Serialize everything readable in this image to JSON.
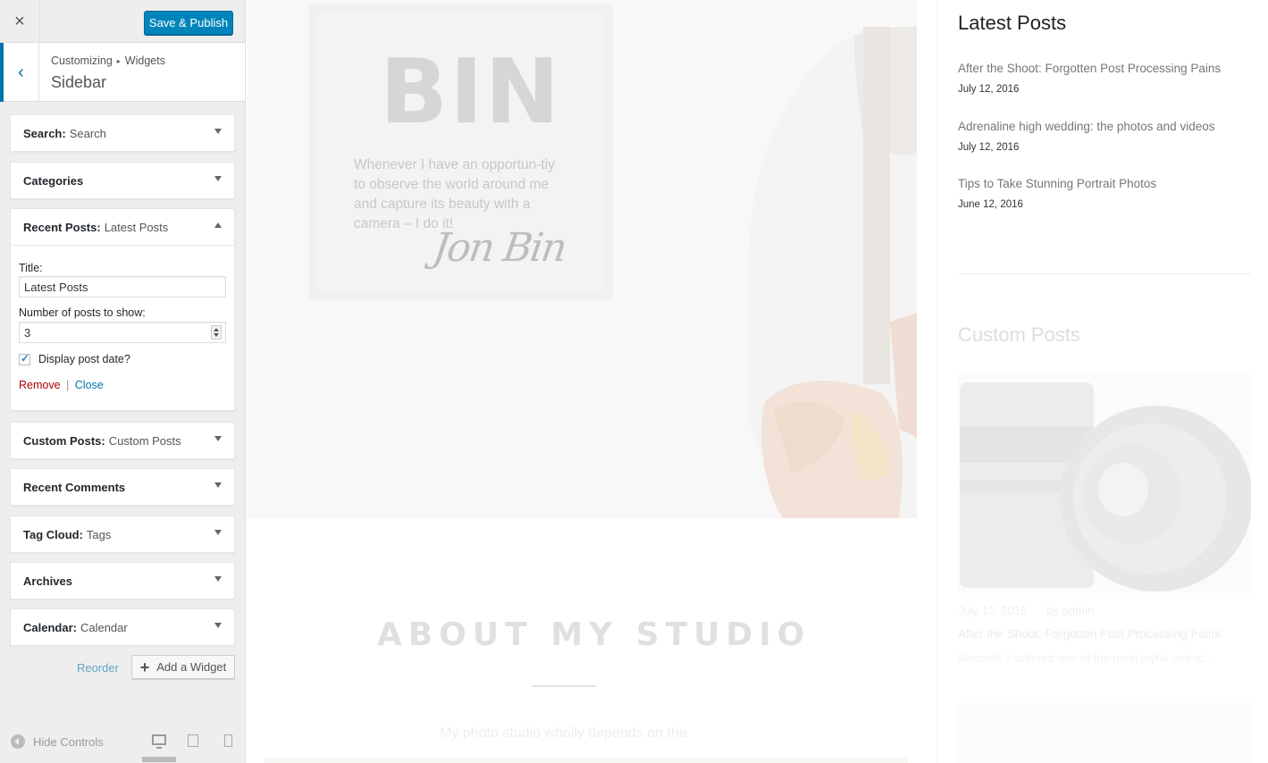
{
  "customizer": {
    "close_icon": "×",
    "publish_label": "Save & Publish",
    "back_icon": "‹",
    "breadcrumb": {
      "root": "Customizing",
      "separator": "▸",
      "section": "Widgets"
    },
    "section_title": "Sidebar",
    "widgets": [
      {
        "name": "Search:",
        "subtitle": "Search"
      },
      {
        "name": "Categories",
        "subtitle": ""
      },
      {
        "name": "Recent Posts:",
        "subtitle": "Latest Posts",
        "expanded": true
      },
      {
        "name": "Custom Posts:",
        "subtitle": "Custom Posts"
      },
      {
        "name": "Recent Comments",
        "subtitle": ""
      },
      {
        "name": "Tag Cloud:",
        "subtitle": "Tags"
      },
      {
        "name": "Archives",
        "subtitle": ""
      },
      {
        "name": "Calendar:",
        "subtitle": "Calendar"
      }
    ],
    "recent_posts_form": {
      "title_label": "Title:",
      "title_value": "Latest Posts",
      "number_label": "Number of posts to show:",
      "number_value": "3",
      "display_date_label": "Display post date?",
      "display_date_checked": true,
      "remove_label": "Remove",
      "separator": "|",
      "close_label": "Close"
    },
    "reorder_label": "Reorder",
    "add_widget_label": "Add a Widget",
    "hide_controls_label": "Hide Controls",
    "devices": [
      "desktop-icon",
      "tablet-icon",
      "mobile-icon"
    ],
    "accent_color": "#0073aa",
    "publish_color": "#0085ba"
  },
  "preview": {
    "hero": {
      "big_text": "BIN",
      "quote": "Whenever I have an opportun-tiy to observe the world around me and capture its beauty with a camera – I do it!",
      "signature": "Jon Bin"
    },
    "about": {
      "title": "ABOUT MY STUDIO",
      "text": "My photo studio wholly depends on the"
    },
    "latest_posts": {
      "title": "Latest Posts",
      "items": [
        {
          "title": "After the Shoot: Forgotten Post Processing Pains",
          "date": "July 12, 2016"
        },
        {
          "title": "Adrenaline high wedding: the photos and videos",
          "date": "July 12, 2016"
        },
        {
          "title": "Tips to Take Stunning Portrait Photos",
          "date": "June 12, 2016"
        }
      ]
    },
    "custom_posts": {
      "title": "Custom Posts",
      "date": "July 12, 2016",
      "author": "by admin",
      "post_title": "After the Shoot: Forgotten Post Processing Pains",
      "excerpt": "Recently I suffered one of the most joyful and at..."
    }
  }
}
